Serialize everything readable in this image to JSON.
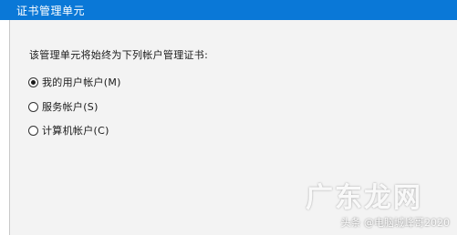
{
  "window": {
    "title": "证书管理单元"
  },
  "panel": {
    "instruction": "该管理单元将始终为下列帐户管理证书:",
    "options": [
      {
        "label": "我的用户帐户(M)",
        "selected": true
      },
      {
        "label": "服务帐户(S)",
        "selected": false
      },
      {
        "label": "计算机帐户(C)",
        "selected": false
      }
    ]
  },
  "watermark": {
    "logo": "广东龙网",
    "caption": "头条 @电脑城峰哥2020"
  },
  "colors": {
    "title_bar": "#0a78d7",
    "panel_bg": "#f3f3f3"
  }
}
